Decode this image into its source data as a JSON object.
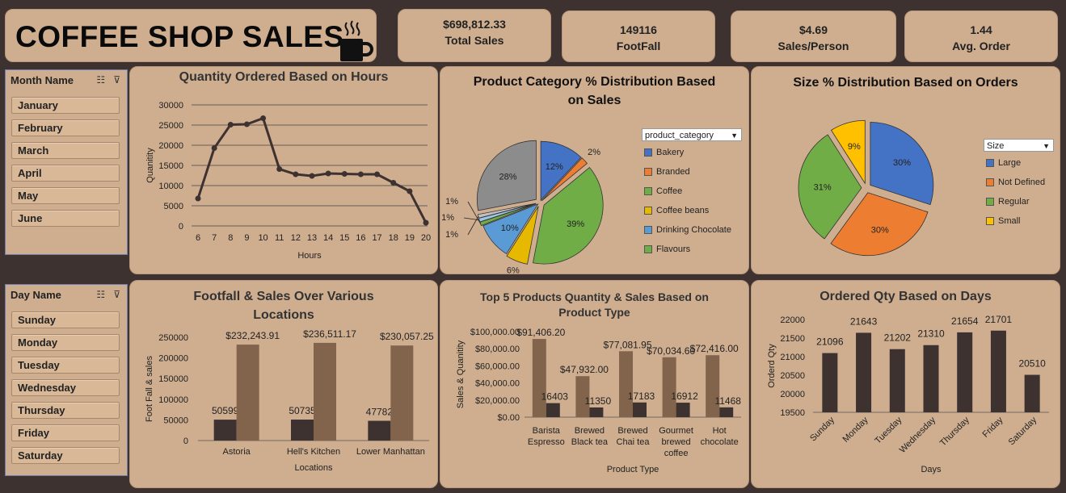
{
  "header": {
    "title": "COFFEE SHOP SALES",
    "icon": "coffee-cup-icon"
  },
  "kpis": [
    {
      "value": "$698,812.33",
      "label": "Total Sales"
    },
    {
      "value": "149116",
      "label": "FootFall"
    },
    {
      "value": "$4.69",
      "label": "Sales/Person"
    },
    {
      "value": "1.44",
      "label": "Avg. Order"
    }
  ],
  "month_slicer": {
    "header": "Month Name",
    "items": [
      "January",
      "February",
      "March",
      "April",
      "May",
      "June"
    ]
  },
  "day_slicer": {
    "header": "Day Name",
    "items": [
      "Sunday",
      "Monday",
      "Tuesday",
      "Wednesday",
      "Thursday",
      "Friday",
      "Saturday"
    ]
  },
  "chart_data": [
    {
      "id": "hours",
      "type": "line",
      "title": "Quantity Ordered Based on Hours",
      "xlabel": "Hours",
      "ylabel": "Quanitity",
      "x": [
        6,
        7,
        8,
        9,
        10,
        11,
        12,
        13,
        14,
        15,
        16,
        17,
        18,
        19,
        20
      ],
      "values": [
        6800,
        19300,
        25100,
        25200,
        26700,
        14100,
        12800,
        12400,
        13000,
        12900,
        12800,
        12800,
        10700,
        8600,
        800
      ],
      "ylim": [
        0,
        30000
      ],
      "yticks": [
        "0",
        "5000",
        "10000",
        "15000",
        "20000",
        "25000",
        "30000"
      ],
      "color": "#3d3230"
    },
    {
      "id": "category",
      "type": "pie",
      "title_line1": "Product Category % Distribution Based",
      "title_line2": "on Sales",
      "legend_header": "product_category",
      "legend": [
        "Bakery",
        "Branded",
        "Coffee",
        "Coffee beans",
        "Drinking Chocolate",
        "Flavours"
      ],
      "slices": [
        {
          "label": "12%",
          "value": 12,
          "color": "#4472c4"
        },
        {
          "label": "2%",
          "value": 2,
          "color": "#ed7d31"
        },
        {
          "label": "39%",
          "value": 39,
          "color": "#70ad47"
        },
        {
          "label": "6%",
          "value": 6,
          "color": "#e6b800"
        },
        {
          "label": "10%",
          "value": 10,
          "color": "#5b9bd5"
        },
        {
          "label": "1%",
          "value": 1,
          "color": "#70ad47"
        },
        {
          "label": "1%",
          "value": 1,
          "color": "#9dc3e6"
        },
        {
          "label": "1%",
          "value": 1,
          "color": "#c0c0c0"
        },
        {
          "label": "28%",
          "value": 28,
          "color": "#8c8c8c"
        }
      ],
      "legend_colors": [
        "#4472c4",
        "#ed7d31",
        "#70ad47",
        "#e6b800",
        "#5b9bd5",
        "#70ad47"
      ]
    },
    {
      "id": "size",
      "type": "pie",
      "title": "Size % Distribution Based on Orders",
      "legend_header": "Size",
      "legend": [
        "Large",
        "Not Defined",
        "Regular",
        "Small"
      ],
      "slices": [
        {
          "label": "30%",
          "value": 30,
          "color": "#4472c4"
        },
        {
          "label": "30%",
          "value": 30,
          "color": "#ed7d31"
        },
        {
          "label": "31%",
          "value": 31,
          "color": "#70ad47"
        },
        {
          "label": "9%",
          "value": 9,
          "color": "#ffc000"
        }
      ],
      "legend_colors": [
        "#4472c4",
        "#ed7d31",
        "#70ad47",
        "#ffc000"
      ]
    },
    {
      "id": "locations",
      "type": "bar",
      "title_line1": "Footfall & Sales Over Various",
      "title_line2": "Locations",
      "xlabel": "Locations",
      "ylabel": "Foot Fall  & sales",
      "categories": [
        "Astoria",
        "Hell's Kitchen",
        "Lower Manhattan"
      ],
      "series": [
        {
          "values": [
            50599,
            50735,
            47782
          ],
          "labels": [
            "50599",
            "50735",
            "47782"
          ],
          "color": "#3d3230"
        },
        {
          "values": [
            232243.91,
            236511.17,
            230057.25
          ],
          "labels": [
            "$232,243.91",
            "$236,511.17",
            "$230,057.25"
          ],
          "color": "#82634c"
        }
      ],
      "ylim": [
        0,
        250000
      ],
      "yticks": [
        "0",
        "50000",
        "100000",
        "150000",
        "200000",
        "250000"
      ]
    },
    {
      "id": "top5",
      "type": "bar",
      "title_line1": "Top 5 Products Quantity & Sales Based on",
      "title_line2": "Product Type",
      "xlabel": "Product Type",
      "ylabel": "Sales & Quanitity",
      "categories": [
        [
          "Barista",
          "Espresso"
        ],
        [
          "Brewed",
          "Black tea"
        ],
        [
          "Brewed",
          "Chai tea"
        ],
        [
          "Gourmet",
          "brewed",
          "coffee"
        ],
        [
          "Hot",
          "chocolate"
        ]
      ],
      "series": [
        {
          "values": [
            91406.2,
            47932.0,
            77081.95,
            70034.6,
            72416.0
          ],
          "labels": [
            "$91,406.20",
            "$47,932.00",
            "$77,081.95",
            "$70,034.60",
            "$72,416.00"
          ],
          "color": "#82634c"
        },
        {
          "values": [
            16403,
            11350,
            17183,
            16912,
            11468
          ],
          "labels": [
            "16403",
            "11350",
            "17183",
            "16912",
            "11468"
          ],
          "color": "#3d3230"
        }
      ],
      "ylim": [
        0,
        100000
      ],
      "yticks": [
        "$0.00",
        "$20,000.00",
        "$40,000.00",
        "$60,000.00",
        "$80,000.00",
        "$100,000.00"
      ]
    },
    {
      "id": "days",
      "type": "bar",
      "title": "Ordered Qty Based on Days",
      "xlabel": "Days",
      "ylabel": "Orderd Qty",
      "categories": [
        "Sunday",
        "Monday",
        "Tuesday",
        "Wednesday",
        "Thursday",
        "Friday",
        "Saturday"
      ],
      "values": [
        21096,
        21643,
        21202,
        21310,
        21654,
        21701,
        20510
      ],
      "labels": [
        "21096",
        "21643",
        "21202",
        "21310",
        "21654",
        "21701",
        "20510"
      ],
      "ylim": [
        19500,
        22000
      ],
      "yticks": [
        "19500",
        "20000",
        "20500",
        "21000",
        "21500",
        "22000"
      ],
      "color": "#3d3230"
    }
  ]
}
